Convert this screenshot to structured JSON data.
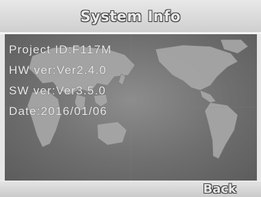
{
  "window": {
    "title": "System Info"
  },
  "info": [
    {
      "key": "project",
      "text": "Project ID:F117M"
    },
    {
      "key": "hw",
      "text": "HW ver:Ver2.4.0"
    },
    {
      "key": "sw",
      "text": "SW ver:Ver3.5.0"
    },
    {
      "key": "date",
      "text": "Date:2016/01/06"
    }
  ],
  "footer": {
    "back_label": "Back"
  },
  "background": {
    "image": "world-map",
    "land_color": "#a7a7a7",
    "sea_color": "#6f6f6f"
  }
}
